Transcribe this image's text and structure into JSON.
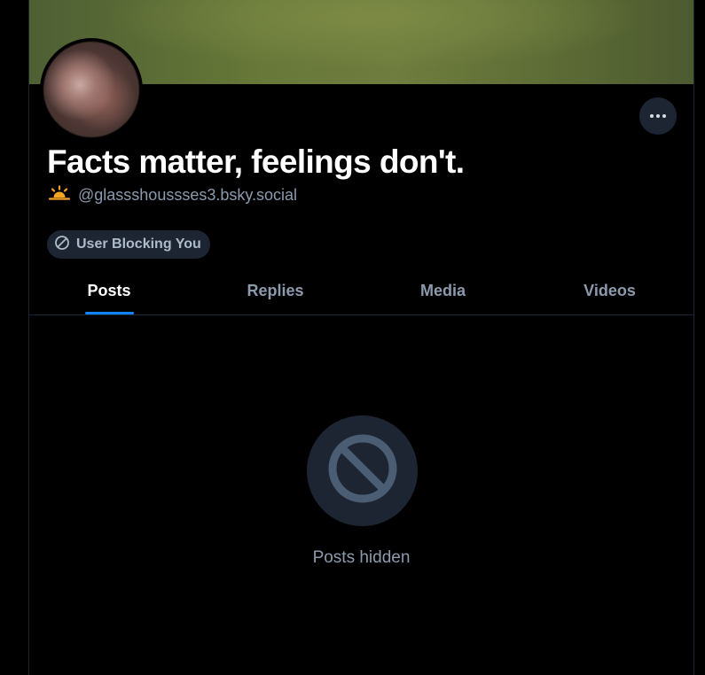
{
  "profile": {
    "display_name": "Facts matter, feelings don't.",
    "handle": "@glassshoussses3.bsky.social",
    "badge_label": "User Blocking You"
  },
  "tabs": [
    {
      "label": "Posts",
      "active": true
    },
    {
      "label": "Replies",
      "active": false
    },
    {
      "label": "Media",
      "active": false
    },
    {
      "label": "Videos",
      "active": false
    }
  ],
  "feed": {
    "empty_message": "Posts hidden"
  },
  "icons": {
    "more": "ellipsis-icon",
    "handle_prefix": "sunrise-icon",
    "badge": "block-icon",
    "empty_state": "block-icon"
  },
  "colors": {
    "accent": "#1083fe",
    "background": "#000000",
    "muted_text": "#8c9aae",
    "pill_bg": "#1e2532",
    "sunrise": "#f5a623"
  }
}
